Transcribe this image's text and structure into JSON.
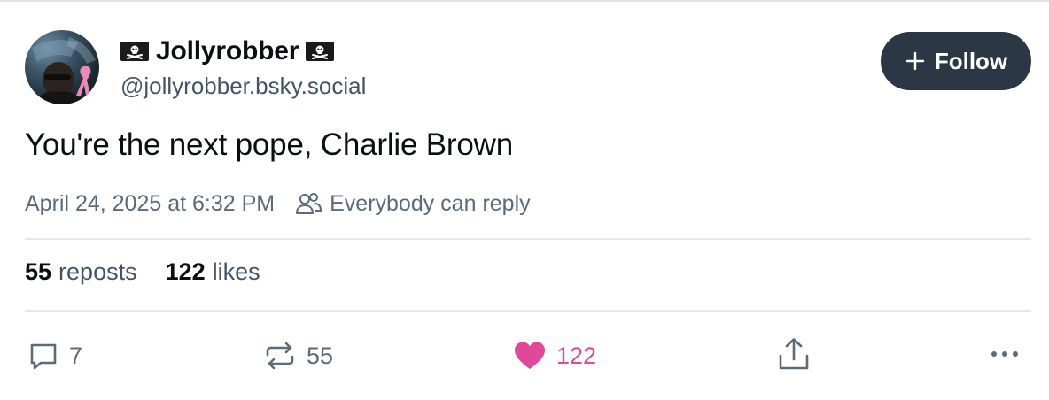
{
  "post": {
    "author": {
      "display_name": "Jollyrobber",
      "handle": "@jollyrobber.bsky.social",
      "name_prefix_icon": "pirate-flag-icon",
      "name_suffix_icon": "pirate-flag-icon"
    },
    "follow_button": {
      "label": "Follow",
      "icon": "plus-icon"
    },
    "text": "You're the next pope, Charlie Brown",
    "timestamp": "April 24, 2025 at 6:32 PM",
    "reply_setting": {
      "icon": "people-icon",
      "label": "Everybody can reply"
    },
    "stats": {
      "reposts_count": "55",
      "reposts_label": "reposts",
      "likes_count": "122",
      "likes_label": "likes"
    },
    "actions": {
      "reply": {
        "icon": "reply-icon",
        "count": "7"
      },
      "repost": {
        "icon": "repost-icon",
        "count": "55"
      },
      "like": {
        "icon": "heart-icon",
        "count": "122",
        "liked": true
      },
      "share": {
        "icon": "share-icon"
      },
      "more": {
        "icon": "more-icon"
      }
    }
  },
  "colors": {
    "text_primary": "#0b0f14",
    "text_secondary": "#425466",
    "follow_bg": "#2b3744",
    "like_pink": "#e0489a",
    "divider": "#e4e8ec"
  }
}
